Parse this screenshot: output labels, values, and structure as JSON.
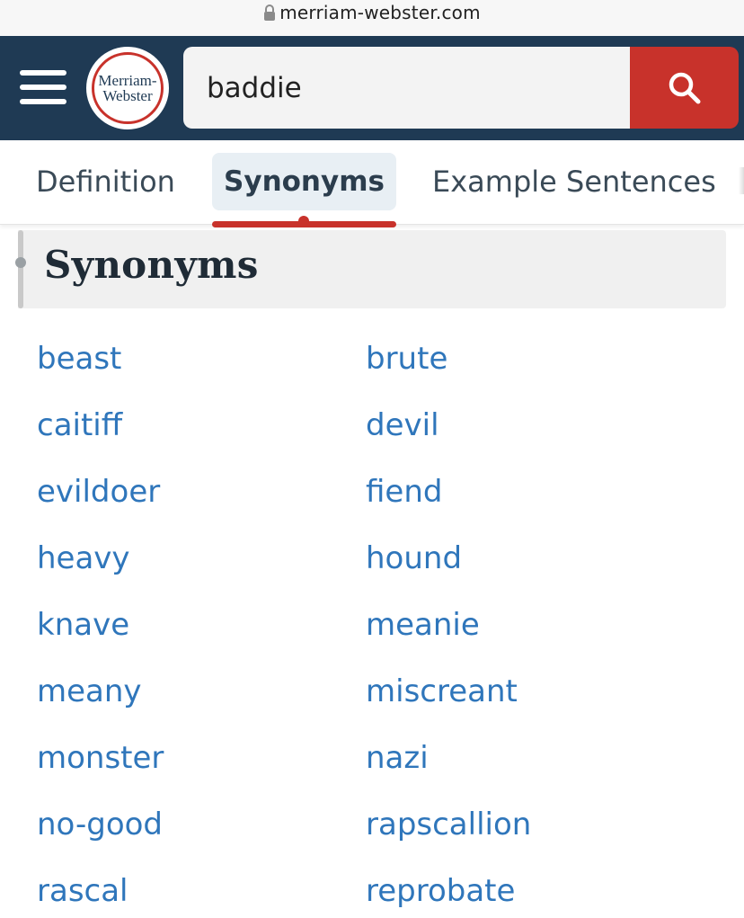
{
  "browser": {
    "url": "merriam-webster.com"
  },
  "header": {
    "logo_line1": "Merriam-",
    "logo_line2": "Webster",
    "search_value": "baddie",
    "colors": {
      "header_bg": "#1f3a54",
      "accent": "#c8322b",
      "link": "#2f76bb"
    }
  },
  "tabs": [
    {
      "label": "Definition",
      "active": false
    },
    {
      "label": "Synonyms",
      "active": true
    },
    {
      "label": "Example Sentences",
      "active": false
    }
  ],
  "section": {
    "title": "Synonyms"
  },
  "synonyms": [
    [
      "beast",
      "brute"
    ],
    [
      "caitiff",
      "devil"
    ],
    [
      "evildoer",
      "fiend"
    ],
    [
      "heavy",
      "hound"
    ],
    [
      "knave",
      "meanie"
    ],
    [
      "meany",
      "miscreant"
    ],
    [
      "monster",
      "nazi"
    ],
    [
      "no-good",
      "rapscallion"
    ],
    [
      "rascal",
      "reprobate"
    ]
  ]
}
